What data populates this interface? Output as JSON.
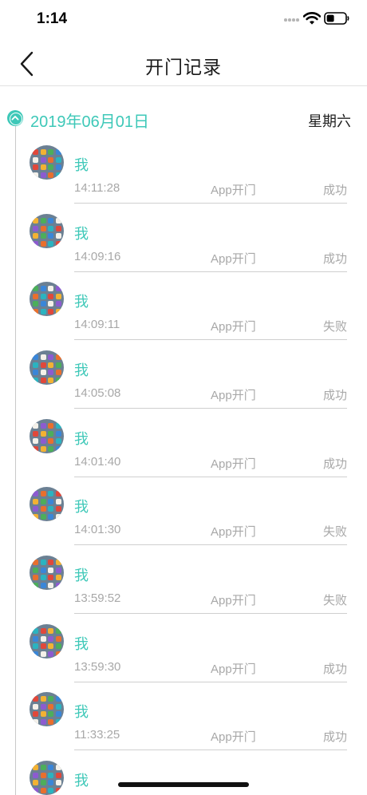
{
  "status_bar": {
    "time": "1:14"
  },
  "nav": {
    "title": "开门记录"
  },
  "section": {
    "date": "2019年06月01日",
    "weekday": "星期六"
  },
  "records": [
    {
      "user": "我",
      "time": "14:11:28",
      "method": "App开门",
      "result": "成功"
    },
    {
      "user": "我",
      "time": "14:09:16",
      "method": "App开门",
      "result": "成功"
    },
    {
      "user": "我",
      "time": "14:09:11",
      "method": "App开门",
      "result": "失败"
    },
    {
      "user": "我",
      "time": "14:05:08",
      "method": "App开门",
      "result": "成功"
    },
    {
      "user": "我",
      "time": "14:01:40",
      "method": "App开门",
      "result": "成功"
    },
    {
      "user": "我",
      "time": "14:01:30",
      "method": "App开门",
      "result": "失败"
    },
    {
      "user": "我",
      "time": "13:59:52",
      "method": "App开门",
      "result": "失败"
    },
    {
      "user": "我",
      "time": "13:59:30",
      "method": "App开门",
      "result": "成功"
    },
    {
      "user": "我",
      "time": "11:33:25",
      "method": "App开门",
      "result": "成功"
    },
    {
      "user": "我"
    }
  ],
  "colors": {
    "accent": "#3ec8b8",
    "secondary_text": "#a8a8a8"
  },
  "icons": {
    "back": "chevron-left-icon",
    "date_marker": "chevron-up-circle-icon"
  }
}
